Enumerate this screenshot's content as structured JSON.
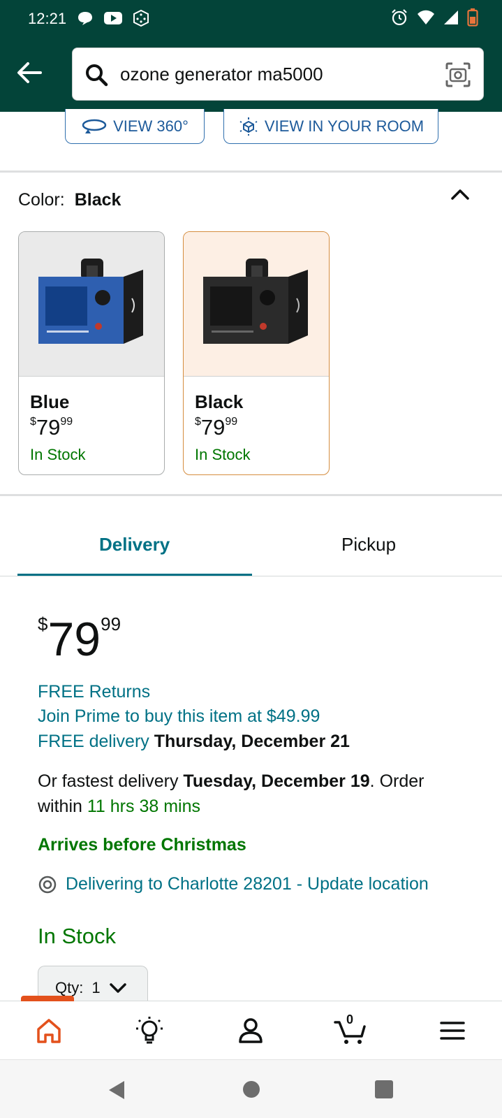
{
  "status_bar": {
    "time": "12:21"
  },
  "search": {
    "query": "ozone generator ma5000"
  },
  "view_buttons": {
    "view_360": "VIEW 360°",
    "view_in_room": "VIEW IN YOUR ROOM"
  },
  "color": {
    "label": "Color:",
    "selected": "Black"
  },
  "swatches": [
    {
      "name": "Blue",
      "currency": "$",
      "whole": "79",
      "fraction": "99",
      "stock": "In Stock",
      "body_color": "#2e5fb0"
    },
    {
      "name": "Black",
      "currency": "$",
      "whole": "79",
      "fraction": "99",
      "stock": "In Stock",
      "body_color": "#2b2b2b"
    }
  ],
  "tabs": {
    "delivery": "Delivery",
    "pickup": "Pickup"
  },
  "price": {
    "currency": "$",
    "whole": "79",
    "fraction": "99"
  },
  "offers": {
    "free_returns": "FREE Returns",
    "prime_offer": "Join Prime to buy this item at $49.99",
    "free_delivery_label": "FREE delivery",
    "free_delivery_date": "Thursday, December 21",
    "fastest_prefix": "Or fastest delivery",
    "fastest_date": "Tuesday, December 19",
    "order_within": ". Order within",
    "countdown": "11 hrs 38 mins",
    "arrives_note": "Arrives before Christmas",
    "location": "Delivering to Charlotte 28201 - Update location",
    "stock_status": "In Stock"
  },
  "quantity": {
    "label": "Qty:",
    "value": "1"
  },
  "bottom_nav": {
    "cart_count": "0"
  },
  "colors": {
    "header_bg": "#034439",
    "link": "#007185",
    "in_stock": "#007600",
    "accent": "#e3511c"
  }
}
